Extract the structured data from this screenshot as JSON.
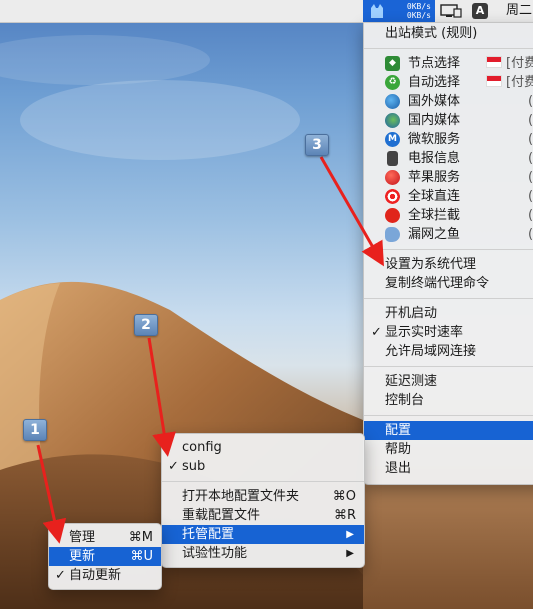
{
  "menubar": {
    "upload_speed": "0KB/s",
    "download_speed": "0KB/s",
    "input_source": "A",
    "clock": "周二"
  },
  "main_menu": {
    "items": [
      {
        "label": "出站模式 (规则)"
      },
      {
        "label": "节点选择",
        "icon": "beginner-icon",
        "right": "[付费"
      },
      {
        "label": "自动选择",
        "icon": "recycle-icon",
        "right": "[付费"
      },
      {
        "label": "国外媒体",
        "icon": "globe-americas-icon",
        "right": ""
      },
      {
        "label": "国内媒体",
        "icon": "globe-asia-icon",
        "right": ""
      },
      {
        "label": "微软服务",
        "icon": "m-circle-icon",
        "right": ""
      },
      {
        "label": "电报信息",
        "icon": "phone-arrow-icon",
        "right": ""
      },
      {
        "label": "苹果服务",
        "icon": "apple-fruit-icon",
        "right": ""
      },
      {
        "label": "全球直连",
        "icon": "target-icon",
        "right": ""
      },
      {
        "label": "全球拦截",
        "icon": "stop-icon",
        "right": ""
      },
      {
        "label": "漏网之鱼",
        "icon": "fish-icon",
        "right": ""
      },
      {
        "label": "设置为系统代理"
      },
      {
        "label": "复制终端代理命令"
      },
      {
        "label": "开机启动"
      },
      {
        "label": "显示实时速率",
        "checked": true
      },
      {
        "label": "允许局域网连接"
      },
      {
        "label": "延迟测速"
      },
      {
        "label": "控制台"
      },
      {
        "label": "配置",
        "selected": true
      },
      {
        "label": "帮助"
      },
      {
        "label": "退出"
      }
    ]
  },
  "config_menu": {
    "items": [
      {
        "label": "config"
      },
      {
        "label": "sub",
        "checked": true
      },
      {
        "label": "打开本地配置文件夹",
        "shortcut": "⌘O"
      },
      {
        "label": "重载配置文件",
        "shortcut": "⌘R"
      },
      {
        "label": "托管配置",
        "arrow": "▶",
        "selected": true
      },
      {
        "label": "试验性功能",
        "arrow": "▶"
      }
    ]
  },
  "update_menu": {
    "items": [
      {
        "label": "管理",
        "shortcut": "⌘M"
      },
      {
        "label": "更新",
        "shortcut": "⌘U",
        "selected": true
      },
      {
        "label": "自动更新",
        "checked": true
      }
    ]
  },
  "checkmark": "✓",
  "badges": [
    "1",
    "2",
    "3"
  ],
  "colors": {
    "selection": "#1763d3",
    "status_item": "#1a64d6",
    "arrow": "#e8211d"
  }
}
